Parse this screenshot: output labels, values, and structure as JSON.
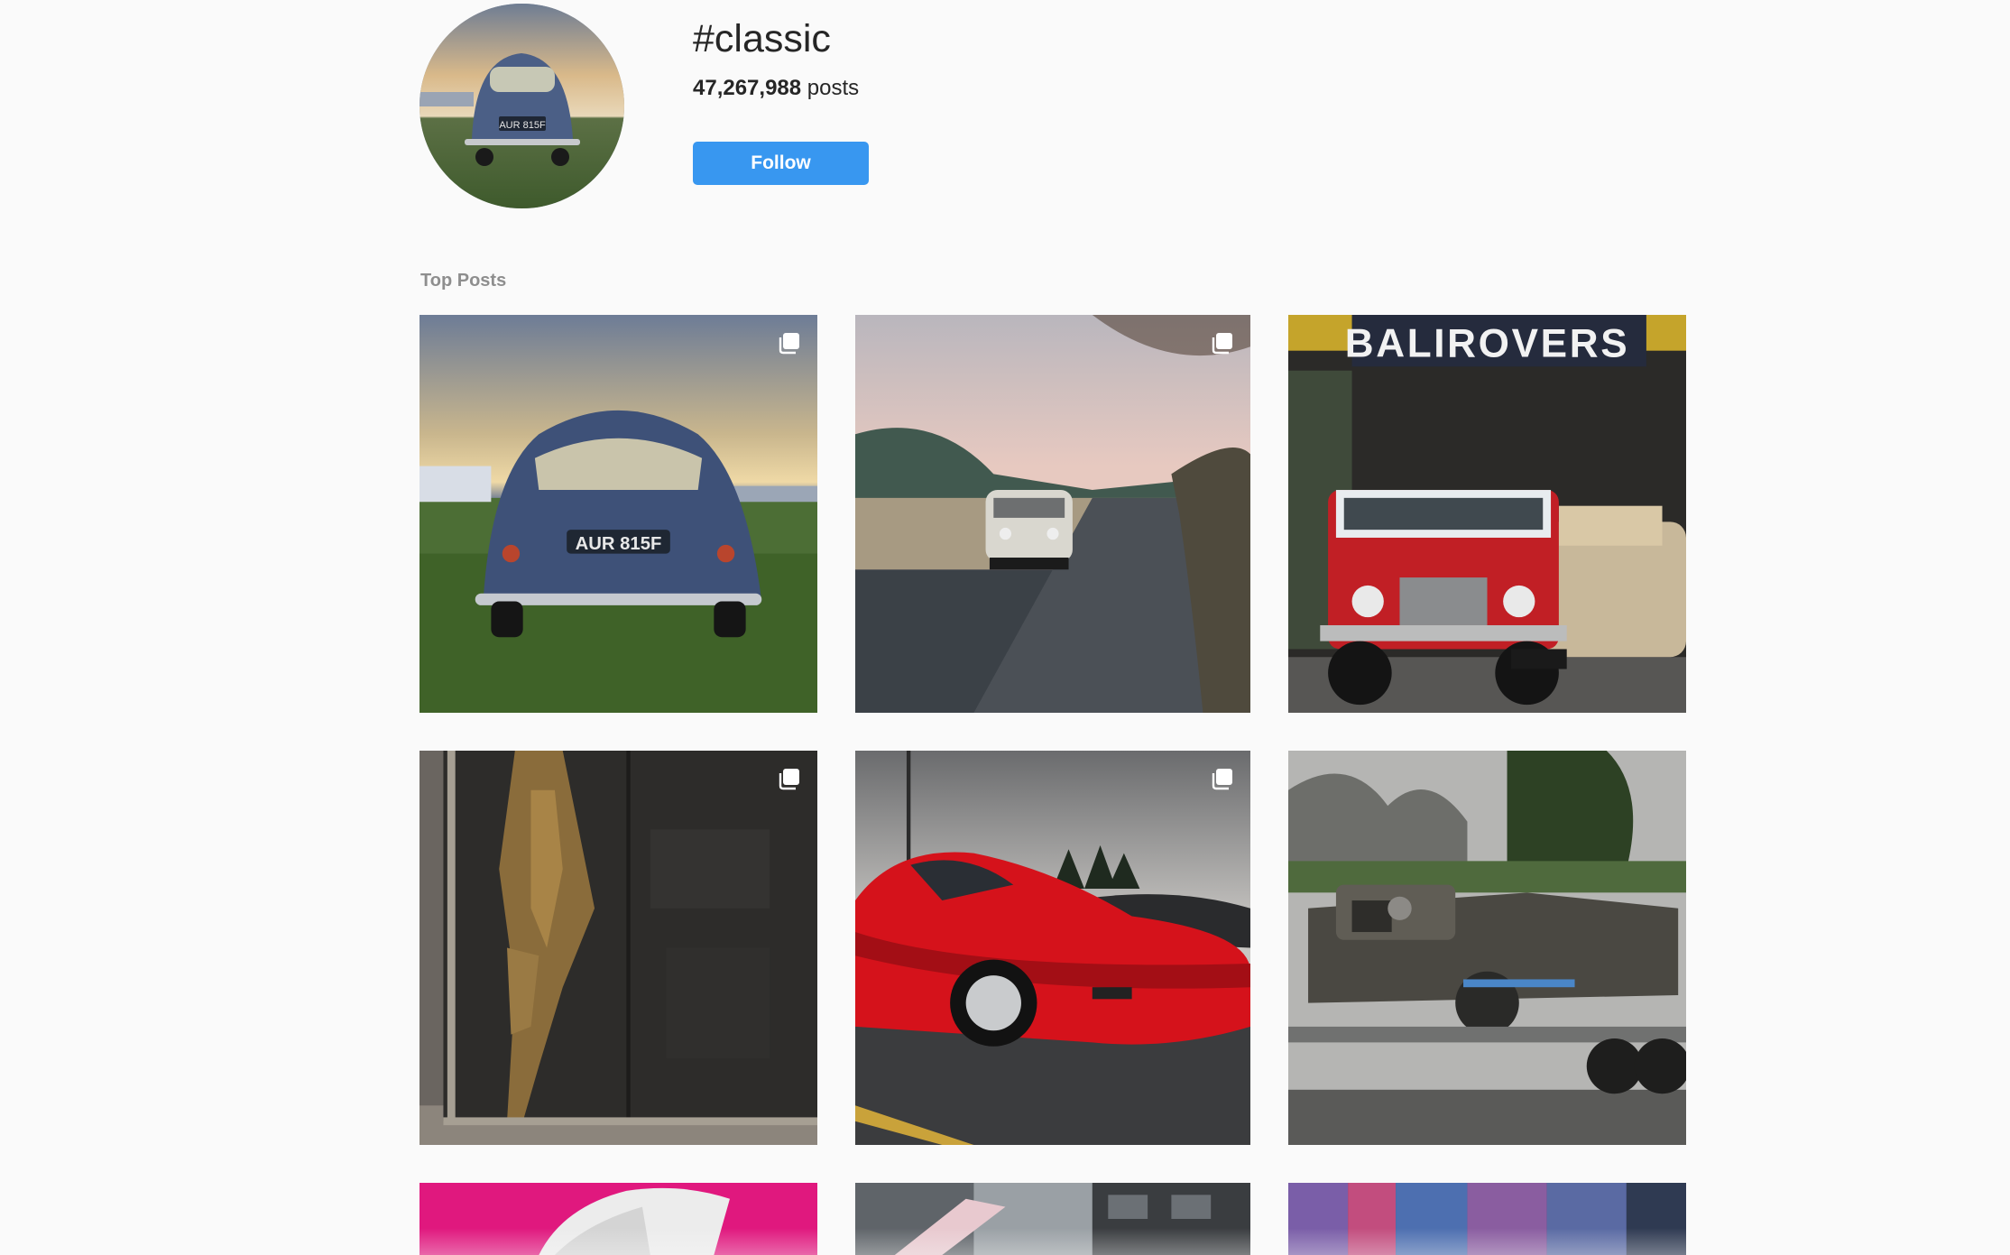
{
  "hashtag": {
    "title": "#classic",
    "post_count_number": "47,267,988",
    "post_count_suffix": "posts",
    "follow_label": "Follow",
    "avatar_icon": "avatar-blue-classic-car"
  },
  "section": {
    "title": "Top Posts"
  },
  "posts": [
    {
      "subject": "Blue classic car with plate AUR 815F at sunset",
      "plate": "AUR 815F",
      "multi": true
    },
    {
      "subject": "White vintage van on a road with mountains",
      "multi": true
    },
    {
      "subject": "Red off-road vehicle under BALIROVERS sign",
      "sign": "BALIROVERS",
      "multi": false
    },
    {
      "subject": "Textured dark metal art panel",
      "multi": true
    },
    {
      "subject": "Red sports car in a parking lot",
      "multi": true
    },
    {
      "subject": "Rusty classic off-road vehicle on a trailer",
      "multi": false
    },
    {
      "subject": "Pink background with white sneaker",
      "multi": false
    },
    {
      "subject": "Street scene with buildings",
      "multi": false
    },
    {
      "subject": "Colorful mural",
      "multi": false
    }
  ],
  "colors": {
    "accent": "#3897f0",
    "muted": "#8e8e8e",
    "background": "#fafafa"
  },
  "icons": {
    "multi_post": "carousel-icon"
  }
}
